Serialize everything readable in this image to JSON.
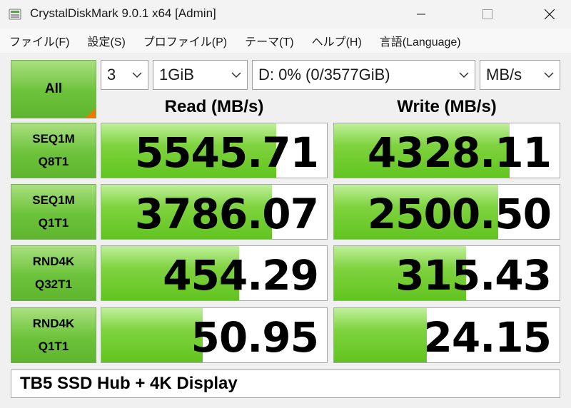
{
  "window": {
    "title": "CrystalDiskMark 9.0.1 x64 [Admin]",
    "min_label": "minimize",
    "max_label": "maximize",
    "close_label": "close"
  },
  "menu": [
    "ファイル(F)",
    "設定(S)",
    "プロファイル(P)",
    "テーマ(T)",
    "ヘルプ(H)",
    "言語(Language)"
  ],
  "controls": {
    "all_label": "All",
    "count": "3",
    "size": "1GiB",
    "drive": "D: 0% (0/3577GiB)",
    "unit": "MB/s"
  },
  "headers": {
    "read": "Read (MB/s)",
    "write": "Write (MB/s)"
  },
  "tests": [
    {
      "line1": "SEQ1M",
      "line2": "Q8T1",
      "read": "5545.71",
      "write": "4328.11",
      "read_fill": 0.775,
      "write_fill": 0.78
    },
    {
      "line1": "SEQ1M",
      "line2": "Q1T1",
      "read": "3786.07",
      "write": "2500.50",
      "read_fill": 0.755,
      "write_fill": 0.727
    },
    {
      "line1": "RND4K",
      "line2": "Q32T1",
      "read": "454.29",
      "write": "315.43",
      "read_fill": 0.61,
      "write_fill": 0.584
    },
    {
      "line1": "RND4K",
      "line2": "Q1T1",
      "read": "50.95",
      "write": "24.15",
      "read_fill": 0.45,
      "write_fill": 0.41
    }
  ],
  "comment": "TB5 SSD Hub + 4K Display",
  "colors": {
    "accent_green": "#6cc23a",
    "corner_orange": "#f07800"
  }
}
